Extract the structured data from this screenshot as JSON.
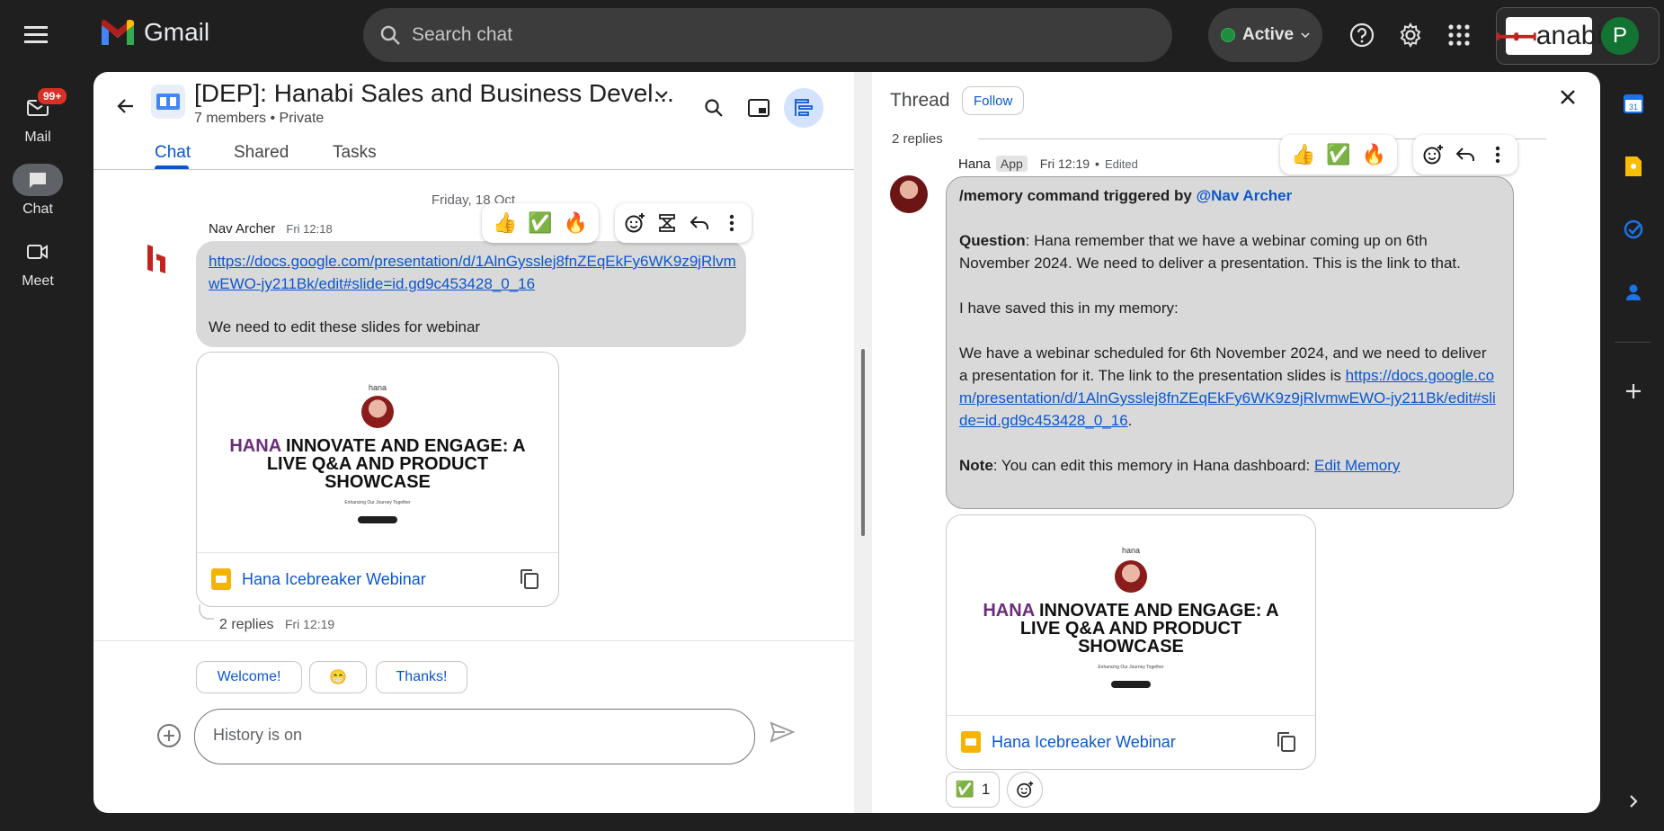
{
  "app": {
    "name": "Gmail"
  },
  "search": {
    "placeholder": "Search chat"
  },
  "status": {
    "label": "Active"
  },
  "brand": {
    "text": "anabi",
    "avatar_letter": "P"
  },
  "rail": {
    "badge": "99+",
    "items": [
      {
        "label": "Mail"
      },
      {
        "label": "Chat"
      },
      {
        "label": "Meet"
      }
    ]
  },
  "room": {
    "title": "[DEP]: Hanabi Sales and Business Devel...",
    "members": "7 members",
    "privacy": "Private"
  },
  "tabs": [
    {
      "label": "Chat"
    },
    {
      "label": "Shared"
    },
    {
      "label": "Tasks"
    }
  ],
  "message": {
    "date": "Friday, 18 Oct",
    "sender": "Nav Archer",
    "time": "Fri 12:18",
    "link": "https://docs.google.com/presentation/d/1AlnGysslej8fnZEqEkFy6WK9z9jRlvmwEWO-jy211Bk/edit#slide=id.gd9c453428_0_16",
    "text": "We need to edit these slides for webinar",
    "replies": "2 replies",
    "replies_time": "Fri 12:19"
  },
  "hover_reactions": [
    "👍",
    "✅",
    "🔥"
  ],
  "attachment": {
    "name": "Hana Icebreaker Webinar",
    "preview_brand": "hana",
    "preview_title_hl": "HANA",
    "preview_title": " INNOVATE AND ENGAGE: A LIVE Q&A AND PRODUCT SHOWCASE",
    "preview_tagline": "Enhancing Our Journey Together"
  },
  "quick_replies": [
    "Welcome!",
    "😁",
    "Thanks!"
  ],
  "compose": {
    "placeholder": "History is on"
  },
  "thread": {
    "title": "Thread",
    "follow": "Follow",
    "replies": "2 replies",
    "sender": "Hana",
    "app_tag": "App",
    "time": "Fri 12:19",
    "edited": "Edited",
    "command_prefix": "/memory command triggered by ",
    "mention": "@Nav Archer",
    "question_label": "Question",
    "question_text": ": Hana remember that we have a webinar coming up on 6th November 2024. We need to deliver a presentation. This is the link to that.",
    "saved_text": "I have saved this in my memory:",
    "memory_text": "We have a webinar scheduled for 6th November 2024, and we need to deliver a presentation for it. The link to the presentation slides is ",
    "memory_link": "https://docs.google.com/presentation/d/1AlnGysslej8fnZEqEkFy6WK9z9jRlvmwEWO-jy211Bk/edit#slide=id.gd9c453428_0_16",
    "memory_end": ".",
    "note_label": "Note",
    "note_text": ": You can edit this memory in Hana dashboard: ",
    "note_link": "Edit Memory",
    "reaction_emoji": "✅",
    "reaction_count": "1"
  }
}
